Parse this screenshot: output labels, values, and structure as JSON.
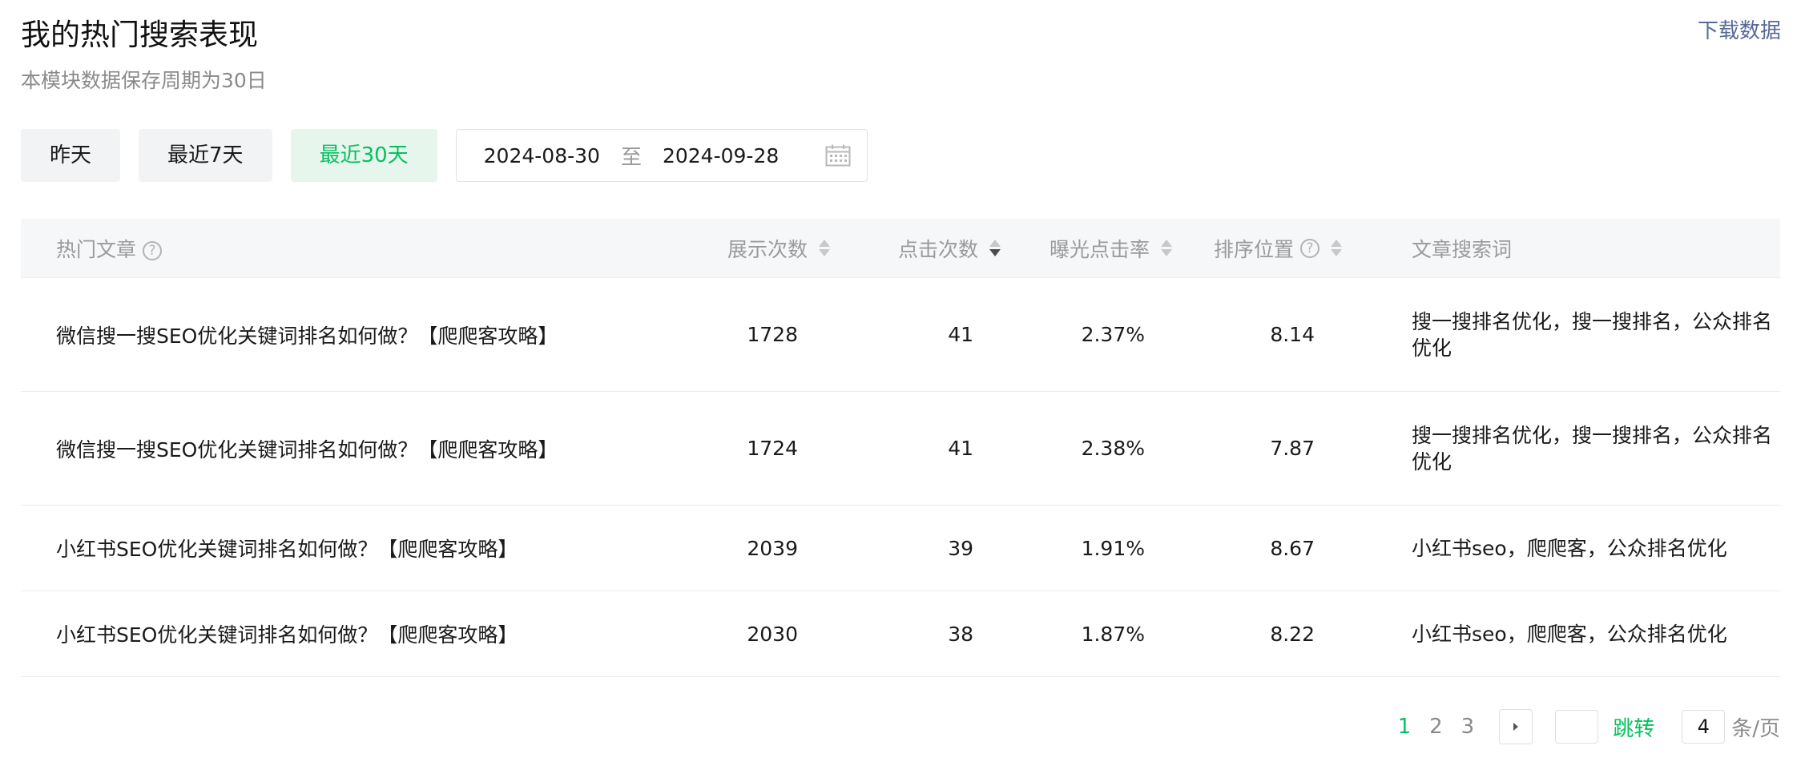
{
  "header": {
    "title": "我的热门搜索表现",
    "subtitle": "本模块数据保存周期为30日",
    "download_label": "下载数据"
  },
  "filters": {
    "buttons": [
      {
        "label": "昨天",
        "active": false
      },
      {
        "label": "最近7天",
        "active": false
      },
      {
        "label": "最近30天",
        "active": true
      }
    ],
    "date_start": "2024-08-30",
    "date_separator": "至",
    "date_end": "2024-09-28"
  },
  "table": {
    "columns": {
      "title": "热门文章",
      "impressions": "展示次数",
      "clicks": "点击次数",
      "ctr": "曝光点击率",
      "rank": "排序位置",
      "keywords": "文章搜索词"
    },
    "rows": [
      {
        "title": "微信搜一搜SEO优化关键词排名如何做？【爬爬客攻略】",
        "impressions": "1728",
        "clicks": "41",
        "ctr": "2.37%",
        "rank": "8.14",
        "keywords": "搜一搜排名优化，搜一搜排名，公众排名优化"
      },
      {
        "title": "微信搜一搜SEO优化关键词排名如何做？【爬爬客攻略】",
        "impressions": "1724",
        "clicks": "41",
        "ctr": "2.38%",
        "rank": "7.87",
        "keywords": "搜一搜排名优化，搜一搜排名，公众排名优化"
      },
      {
        "title": "小红书SEO优化关键词排名如何做？【爬爬客攻略】",
        "impressions": "2039",
        "clicks": "39",
        "ctr": "1.91%",
        "rank": "8.67",
        "keywords": "小红书seo，爬爬客，公众排名优化"
      },
      {
        "title": "小红书SEO优化关键词排名如何做？【爬爬客攻略】",
        "impressions": "2030",
        "clicks": "38",
        "ctr": "1.87%",
        "rank": "8.22",
        "keywords": "小红书seo，爬爬客，公众排名优化"
      }
    ]
  },
  "pagination": {
    "pages": [
      "1",
      "2",
      "3"
    ],
    "current_page": "1",
    "jump_label": "跳转",
    "page_size": "4",
    "page_size_unit": "条/页"
  },
  "colors": {
    "accent": "#07c160",
    "link": "#576b95",
    "header_bg": "#f6f7f9"
  }
}
